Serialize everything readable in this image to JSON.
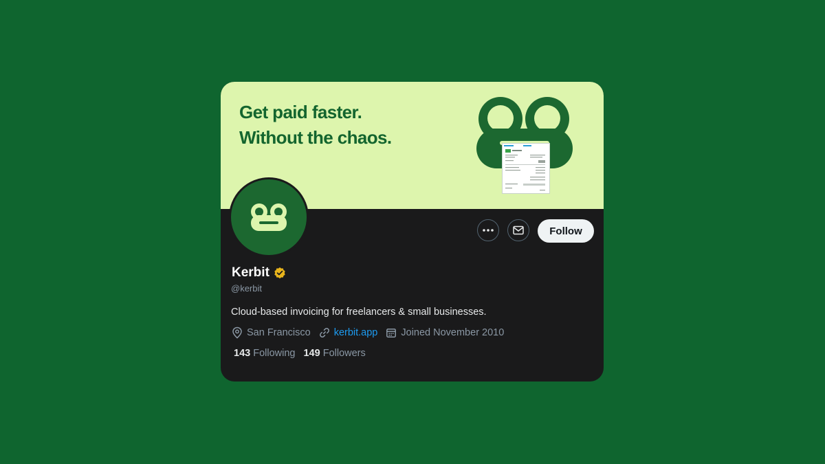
{
  "banner": {
    "tagline_line1": "Get paid faster.",
    "tagline_line2": "Without the chaos.",
    "background": "#ddf5ad",
    "accent": "#13652e"
  },
  "profile": {
    "name": "Kerbit",
    "handle": "@kerbit",
    "bio": "Cloud-based invoicing for freelancers & small businesses.",
    "location": "San Francisco",
    "website": "kerbit.app",
    "joined": "Joined November 2010",
    "verified_badge_color": "#e8b41c"
  },
  "actions": {
    "more_icon": "ellipsis-icon",
    "message_icon": "envelope-icon",
    "follow_label": "Follow"
  },
  "stats": {
    "following_count": "143",
    "following_label": "Following",
    "followers_count": "149",
    "followers_label": "Followers"
  },
  "colors": {
    "page_background": "#0f652f",
    "card_background": "#1a1a1b",
    "link": "#1d9bf0"
  }
}
